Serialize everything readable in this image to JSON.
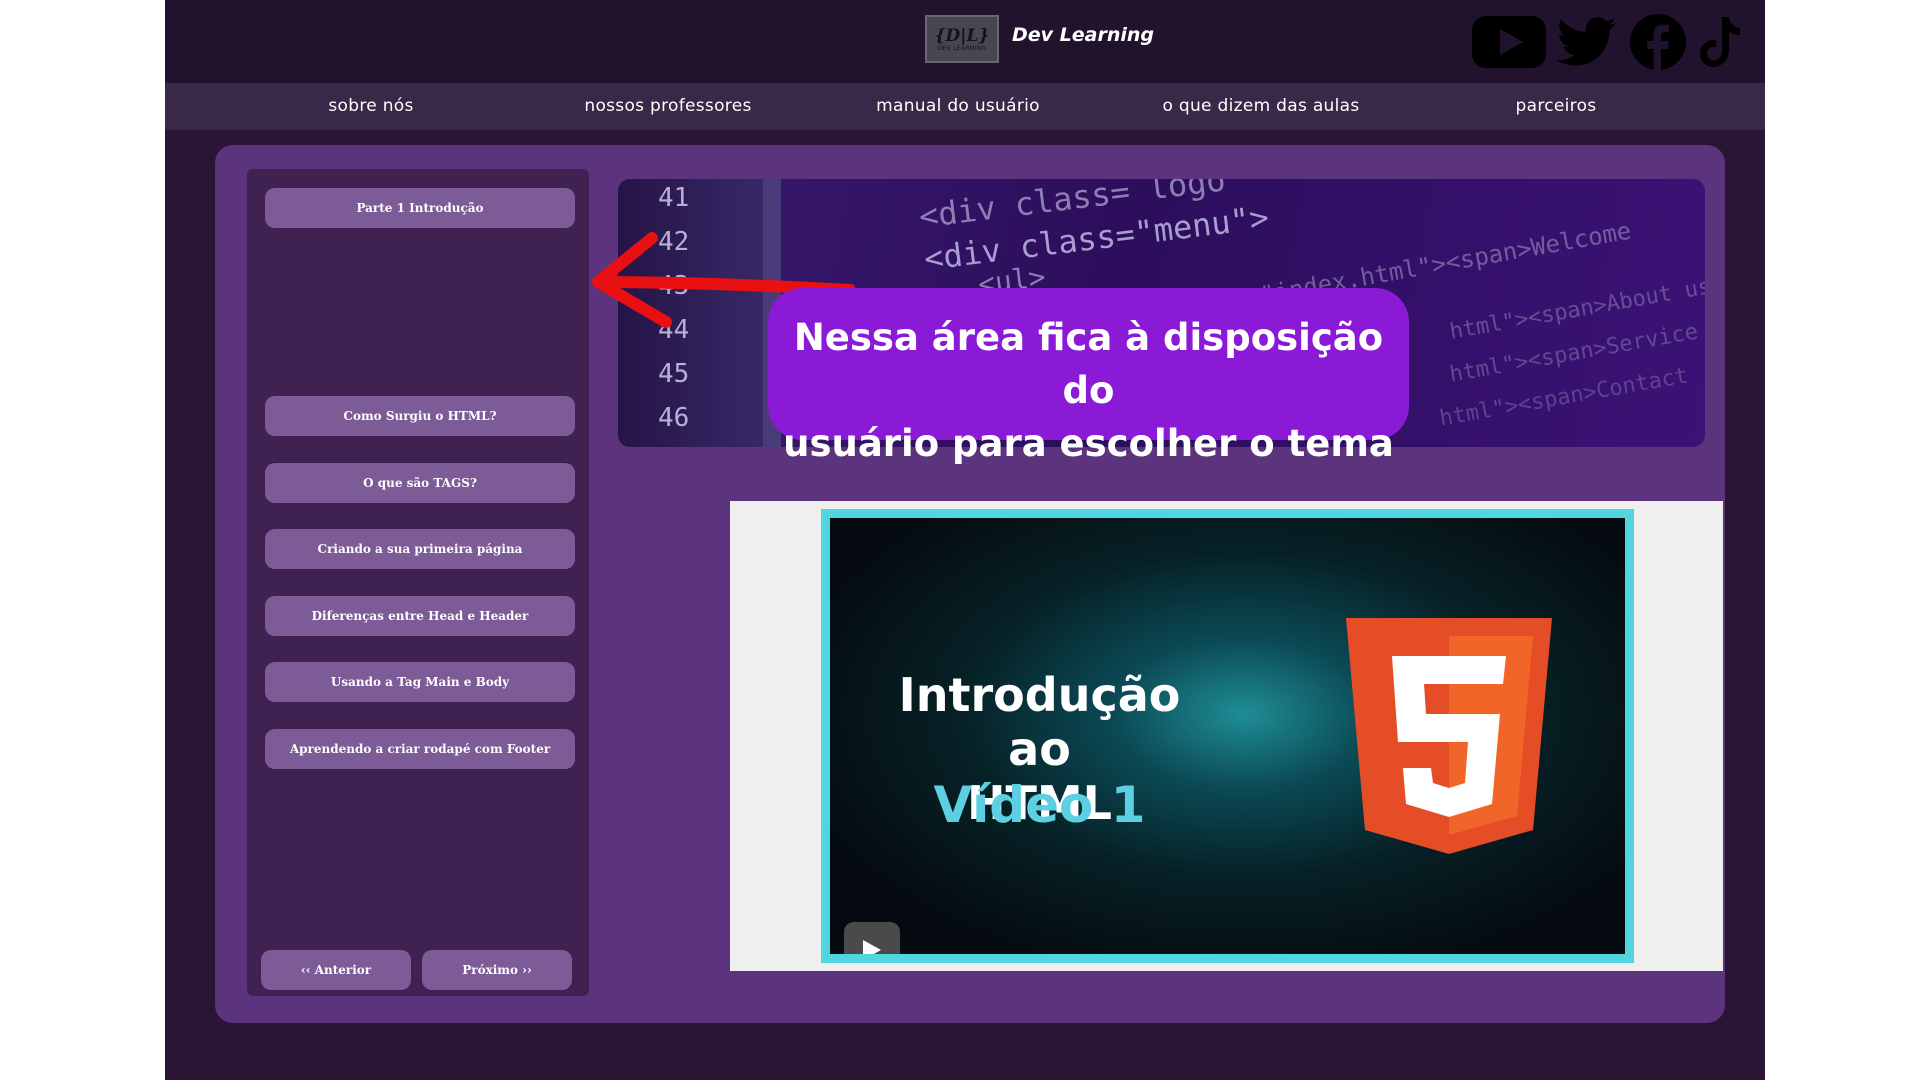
{
  "header": {
    "logo_text": "{D|L}",
    "logo_subtext": "DEV LEARNING",
    "brand": "Dev Learning",
    "social": [
      {
        "icon": "youtube-icon"
      },
      {
        "icon": "twitter-icon"
      },
      {
        "icon": "facebook-icon"
      },
      {
        "icon": "tiktok-icon"
      }
    ]
  },
  "nav": {
    "items": [
      {
        "label": "sobre nós"
      },
      {
        "label": "nossos professores"
      },
      {
        "label": "manual do usuário"
      },
      {
        "label": "o que dizem das aulas"
      },
      {
        "label": "parceiros"
      }
    ]
  },
  "sidebar": {
    "part_label": "Parte 1  Introdução",
    "topics": [
      {
        "label": "Como Surgiu o HTML?"
      },
      {
        "label": "O que são TAGS?"
      },
      {
        "label": "Criando a sua primeira página"
      },
      {
        "label": "Diferenças entre Head e Header"
      },
      {
        "label": "Usando a Tag Main e Body"
      },
      {
        "label": "Aprendendo a criar rodapé com Footer"
      }
    ],
    "prev_label": "‹‹ Anterior",
    "next_label": "Próximo ››"
  },
  "banner": {
    "line_numbers": [
      "41",
      "42",
      "43",
      "44",
      "45",
      "46"
    ],
    "code_lines": [
      "<div class= logo",
      "<div class=\"menu\">",
      "<ul>",
      "\"index.html\"><span>Welcome",
      "html\"><span>About us",
      "html\"><span>Service",
      "html\"><span>Contact"
    ]
  },
  "callout": {
    "line1": "Nessa área fica à disposição do",
    "line2": "usuário para escolher o tema"
  },
  "video": {
    "title_line1": "Introdução ao",
    "title_line2": "HTML",
    "subtitle": "Vídeo 1"
  },
  "colors": {
    "page_bg": "#2a1535",
    "header_bg": "#21122e",
    "nav_bg": "#3a2848",
    "panel_bg": "#5b347d",
    "sidebar_bg": "#3f2251",
    "button_bg": "#7c5b96",
    "callout_bg": "#8a1ad6",
    "arrow": "#e81010",
    "video_border": "#4fd6e0",
    "html5_orange": "#e44d26"
  }
}
